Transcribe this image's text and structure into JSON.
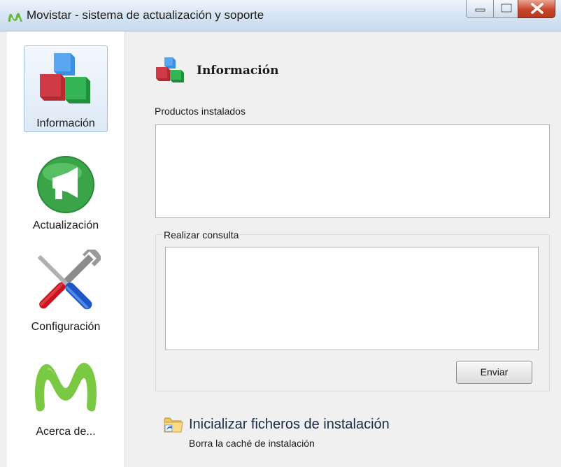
{
  "window": {
    "title": "Movistar - sistema de actualización y soporte",
    "controls": [
      "minimize-icon",
      "maximize-icon",
      "close-icon"
    ]
  },
  "sidebar": {
    "items": [
      {
        "label": "Información",
        "icon": "cubes-icon",
        "selected": true
      },
      {
        "label": "Actualización",
        "icon": "megaphone-icon",
        "selected": false
      },
      {
        "label": "Configuración",
        "icon": "tools-icon",
        "selected": false
      },
      {
        "label": "Acerca de...",
        "icon": "movistar-logo-icon",
        "selected": false
      }
    ]
  },
  "main": {
    "section_title": "Información",
    "section_icon": "cubes-icon",
    "installed_label": "Productos instalados",
    "installed_value": "",
    "query_group_label": "Realizar consulta",
    "query_value": "",
    "send_button": "Enviar",
    "reset_link_title": "Inicializar ficheros de instalación",
    "reset_link_subtitle": "Borra la caché de instalación",
    "reset_link_icon": "shortcut-folder-icon"
  },
  "colors": {
    "title_bar": "#d9e6f4",
    "close_button": "#c8462a",
    "selected_item": "#dde9f7",
    "brand_green": "#6cc24a"
  }
}
